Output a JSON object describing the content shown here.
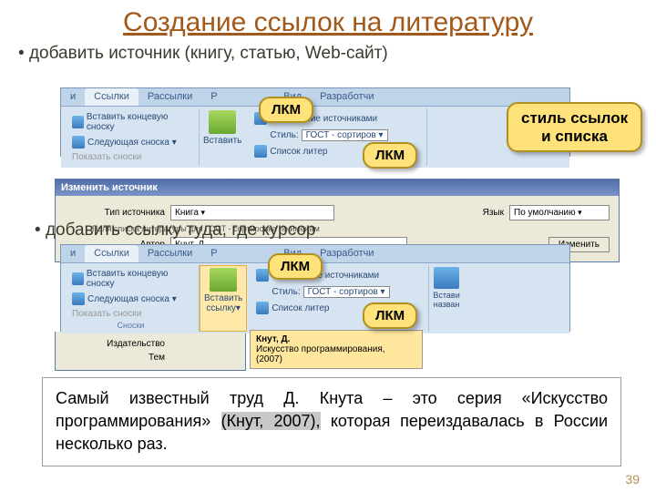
{
  "title": "Создание ссылок на литературу",
  "bullet1": "добавить источник (книгу, статью, Web-сайт)",
  "bullet2": "добавить ссылку туда, где курсор",
  "ribbon": {
    "tabs": [
      "и",
      "Ссылки",
      "Рассылки",
      "Р",
      "Вид",
      "Разработчи"
    ],
    "endnote": "Вставить концевую сноску",
    "nextnote": "Следующая сноска ▾",
    "shownotes": "Показать сноски",
    "group_notes": "Сноски",
    "insert_big": "Вставить",
    "insert_citation": "Вставить\nссылку▾",
    "manage": "Управление источниками",
    "style_lbl": "Стиль:",
    "style_val": "ГОСТ - сортиров ▾",
    "biblio": "Список литер",
    "insert_title": "Встави\nназван"
  },
  "dialog": {
    "title": "Изменить источник",
    "type_lbl": "Тип источника",
    "type_val": "Книга",
    "lang_lbl": "Язык",
    "lang_val": "По умолчанию",
    "gost_line": "Поля списка литературы для ГОСТ - сортировка по именам",
    "author_lbl": "Автор",
    "author_val": "Кнут, Д.",
    "edit_btn": "Изменить",
    "publisher_lbl": "Издательство",
    "theme_lbl": "Тем"
  },
  "lkm": "ЛКМ",
  "callout_style": "стиль ссылок\nи списка",
  "tooltip": {
    "author": "Кнут, Д.",
    "work": "Искусство программирования,",
    "year": "(2007)"
  },
  "doc": {
    "l1": "Самый известный труд Д. Кнута – это серия",
    "l2a": "«Искусство программирования» ",
    "l2b": "(Кнут, 2007),",
    "l2c": " которая",
    "l3": "переиздавалась в России несколько раз."
  },
  "page_num": "39"
}
